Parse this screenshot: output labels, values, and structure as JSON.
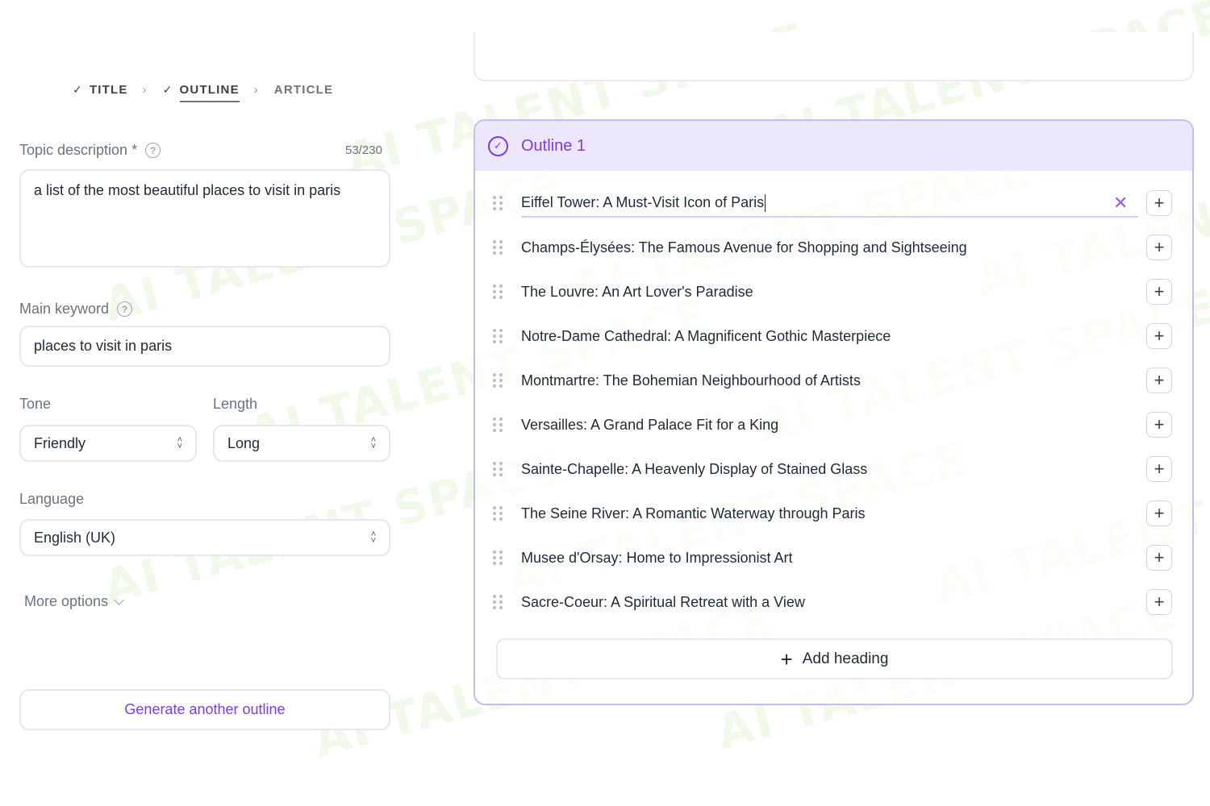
{
  "stepper": {
    "steps": [
      {
        "label": "TITLE",
        "check": "✓"
      },
      {
        "label": "OUTLINE",
        "check": "✓"
      },
      {
        "label": "ARTICLE"
      }
    ]
  },
  "form": {
    "topic": {
      "label": "Topic description *",
      "counter": "53/230",
      "value": "a list of the most beautiful places to visit in paris"
    },
    "keyword": {
      "label": "Main keyword",
      "value": "places to visit in paris"
    },
    "tone": {
      "label": "Tone",
      "value": "Friendly"
    },
    "length": {
      "label": "Length",
      "value": "Long"
    },
    "language": {
      "label": "Language",
      "value": "English (UK)"
    },
    "more_options": "More options",
    "generate_button": "Generate another outline"
  },
  "outline": {
    "title": "Outline 1",
    "headings": [
      "Eiffel Tower: A Must-Visit Icon of Paris",
      "Champs-Élysées: The Famous Avenue for Shopping and Sightseeing",
      "The Louvre: An Art Lover's Paradise",
      "Notre-Dame Cathedral: A Magnificent Gothic Masterpiece",
      "Montmartre: The Bohemian Neighbourhood of Artists",
      "Versailles: A Grand Palace Fit for a King",
      "Sainte-Chapelle: A Heavenly Display of Stained Glass",
      "The Seine River: A Romantic Waterway through Paris",
      "Musee d'Orsay: Home to Impressionist Art",
      "Sacre-Coeur: A Spiritual Retreat with a View"
    ],
    "add_heading_label": "Add heading"
  },
  "watermark": "AI TALENT SPACE",
  "icons": {
    "help": "help-circle-icon",
    "select": "chevron-up-down-icon",
    "drag": "drag-handle-icon",
    "plus": "plus-icon",
    "clear": "close-icon",
    "check": "check-circle-icon"
  },
  "colors": {
    "accent": "#7c3aed",
    "header_bg": "#ede7fd",
    "border": "#c8b9f5"
  }
}
